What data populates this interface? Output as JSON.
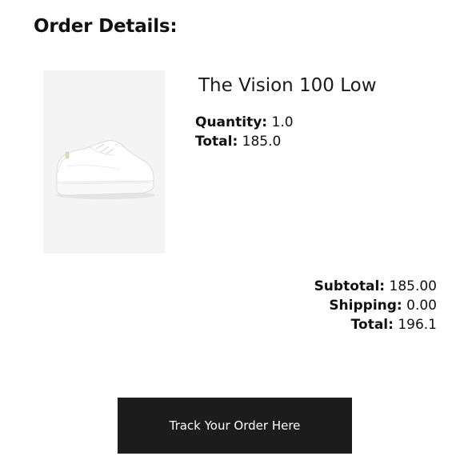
{
  "page": {
    "title": "Order Details:"
  },
  "item": {
    "name": "The Vision 100 Low",
    "image_icon": "sneaker-image",
    "quantity_label": "Quantity:",
    "quantity_value": "1.0",
    "total_label": "Total:",
    "total_value": "185.0"
  },
  "summary": {
    "subtotal_label": "Subtotal:",
    "subtotal_value": "185.00",
    "shipping_label": "Shipping:",
    "shipping_value": "0.00",
    "total_label": "Total:",
    "total_value": "196.1"
  },
  "actions": {
    "track_label": "Track Your Order Here"
  },
  "colors": {
    "button_background": "#1c1c1c",
    "button_text": "#ffffff",
    "image_background": "#f4f4f4"
  }
}
